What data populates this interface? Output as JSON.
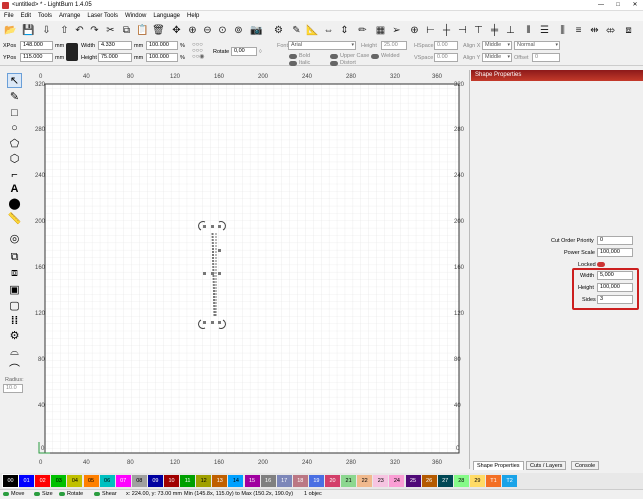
{
  "window": {
    "title": "<untitled> * - LightBurn 1.4.05",
    "minimize": "—",
    "maximize": "□",
    "close": "✕"
  },
  "menu": [
    "File",
    "Edit",
    "Tools",
    "Arrange",
    "Laser Tools",
    "Window",
    "Language",
    "Help"
  ],
  "props": {
    "xpos_label": "XPos",
    "xpos": "148.000",
    "ypos_label": "YPos",
    "ypos": "115.000",
    "unit": "mm",
    "width_label": "Width",
    "width": "4.330",
    "height_label": "Height",
    "height": "75.000",
    "wpct": "100.000",
    "hpct": "100.000",
    "pct": "%",
    "rotate_label": "Rotate",
    "rotate": "0,00",
    "font_label": "Font",
    "font": "Arial",
    "fheight_label": "Height",
    "fheight": "25.00",
    "hspace_label": "HSpace",
    "hspace": "0.00",
    "vspace_label": "VSpace",
    "vspace": "0.00",
    "alignx_label": "Align X",
    "alignx": "Middle",
    "aligny_label": "Align Y",
    "aligny": "Middle",
    "normal": "Normal",
    "offset_label": "Offset",
    "offset": "0",
    "bold": "Bold",
    "italic": "Italic",
    "upper": "Upper Case",
    "distort": "Distort",
    "welded": "Welded"
  },
  "ruler": {
    "top": [
      "0",
      "40",
      "80",
      "120",
      "160",
      "200",
      "240",
      "280",
      "320",
      "360"
    ],
    "bottom": [
      "0",
      "40",
      "80",
      "120",
      "160",
      "200",
      "240",
      "280",
      "320",
      "360"
    ],
    "left": [
      "320",
      "280",
      "240",
      "200",
      "160",
      "120",
      "80",
      "40",
      "0"
    ],
    "right": [
      "320",
      "280",
      "240",
      "200",
      "160",
      "120",
      "80",
      "40",
      "0"
    ]
  },
  "left_tools": {
    "radius_label": "Radius:",
    "radius_value": "10.0"
  },
  "panel": {
    "title": "Shape Properties",
    "cut_order_label": "Cut Order Priority",
    "cut_order": "0",
    "power_scale_label": "Power Scale",
    "power_scale": "100,000",
    "locked_label": "Locked",
    "width_label": "Width",
    "width": "5,000",
    "height_label": "Height",
    "height": "100,000",
    "sides_label": "Sides",
    "sides": "3",
    "tabs": [
      "Shape Properties",
      "Cuts / Layers",
      "Console"
    ]
  },
  "palette": [
    {
      "l": "00",
      "c": "#000000"
    },
    {
      "l": "01",
      "c": "#0000ff"
    },
    {
      "l": "02",
      "c": "#ff0000"
    },
    {
      "l": "03",
      "c": "#00c000"
    },
    {
      "l": "04",
      "c": "#c0c000"
    },
    {
      "l": "05",
      "c": "#ff8000"
    },
    {
      "l": "06",
      "c": "#00c0c0"
    },
    {
      "l": "07",
      "c": "#ff00ff"
    },
    {
      "l": "08",
      "c": "#a0a0a0"
    },
    {
      "l": "09",
      "c": "#0000a0"
    },
    {
      "l": "10",
      "c": "#a00000"
    },
    {
      "l": "11",
      "c": "#00a000"
    },
    {
      "l": "12",
      "c": "#a0a000"
    },
    {
      "l": "13",
      "c": "#c06000"
    },
    {
      "l": "14",
      "c": "#00a0ff"
    },
    {
      "l": "15",
      "c": "#a000a0"
    },
    {
      "l": "16",
      "c": "#808080"
    },
    {
      "l": "17",
      "c": "#7d87b9"
    },
    {
      "l": "18",
      "c": "#bb7784"
    },
    {
      "l": "19",
      "c": "#4a6fe3"
    },
    {
      "l": "20",
      "c": "#d33f6a"
    },
    {
      "l": "21",
      "c": "#8cd78f"
    },
    {
      "l": "22",
      "c": "#f0b98d"
    },
    {
      "l": "23",
      "c": "#f6c4e1"
    },
    {
      "l": "24",
      "c": "#fa9ed4"
    },
    {
      "l": "25",
      "c": "#500a78"
    },
    {
      "l": "26",
      "c": "#b45a00"
    },
    {
      "l": "27",
      "c": "#004754"
    },
    {
      "l": "28",
      "c": "#86fa88"
    },
    {
      "l": "29",
      "c": "#ffdb66"
    },
    {
      "l": "T1",
      "c": "#f36f24"
    },
    {
      "l": "T2",
      "c": "#1aa3e8"
    }
  ],
  "status": {
    "move": "Move",
    "size": "Size",
    "rotate": "Rotate",
    "shear": "Shear",
    "coords": "x: 224.00, y: 73.00 mm",
    "minmax": "Min (145.8x, 115.0y) to Max (150.2x, 190.0y)",
    "objects": "1 objec"
  }
}
